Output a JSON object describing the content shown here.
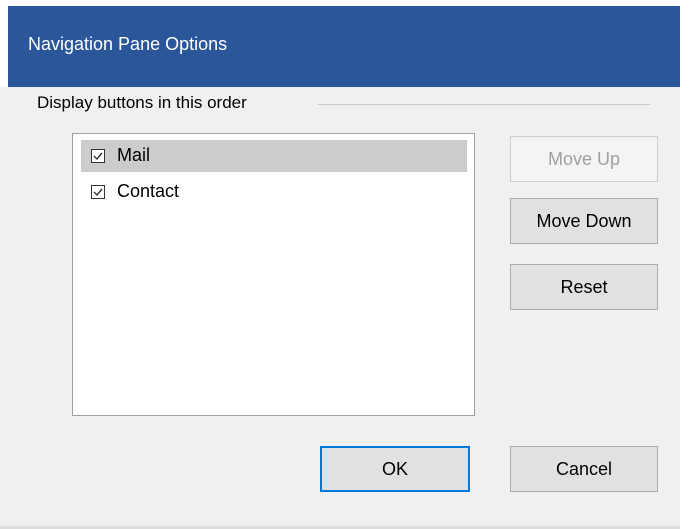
{
  "window": {
    "title": "Navigation Pane Options",
    "accent_color": "#2b579a"
  },
  "group": {
    "label": "Display buttons in this order"
  },
  "list": {
    "items": [
      {
        "label": "Mail",
        "checked": true,
        "selected": true
      },
      {
        "label": "Contact",
        "checked": true,
        "selected": false
      }
    ]
  },
  "buttons": {
    "move_up": "Move Up",
    "move_down": "Move Down",
    "reset": "Reset",
    "ok": "OK",
    "cancel": "Cancel"
  },
  "icons": {
    "check": "check-icon"
  }
}
